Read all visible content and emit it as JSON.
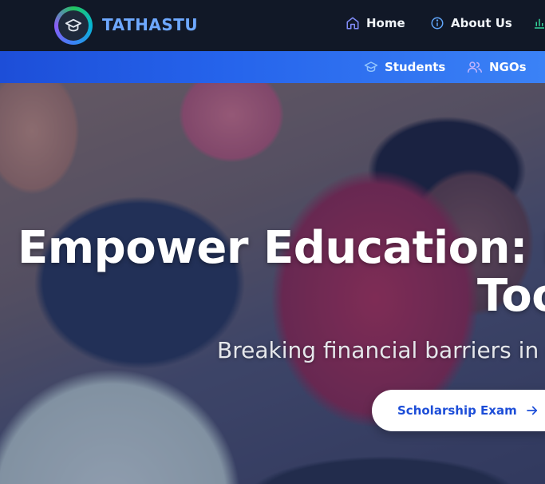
{
  "header": {
    "brand": "TATHASTU",
    "logo_icon": "graduation-cap-icon",
    "nav": [
      {
        "label": "Home",
        "icon": "home-icon"
      },
      {
        "label": "About Us",
        "icon": "info-icon"
      },
      {
        "label": "",
        "icon": "bar-chart-icon"
      }
    ]
  },
  "subnav": {
    "items": [
      {
        "label": "Students",
        "icon": "graduation-cap-icon"
      },
      {
        "label": "NGOs",
        "icon": "users-icon"
      }
    ]
  },
  "hero": {
    "title_line1": "Empower Education: Dor",
    "title_line2": "Too",
    "subtitle": "Breaking financial barriers in ed",
    "cta_label": "Scholarship Exam",
    "cta_icon": "arrow-right-icon"
  },
  "colors": {
    "topbar_bg": "#111827",
    "brand_text": "#6ea8fe",
    "subbar_bg": "#2563eb",
    "cta_text": "#1d4ed8",
    "icon_purple": "#818cf8",
    "icon_green": "#34d399"
  }
}
